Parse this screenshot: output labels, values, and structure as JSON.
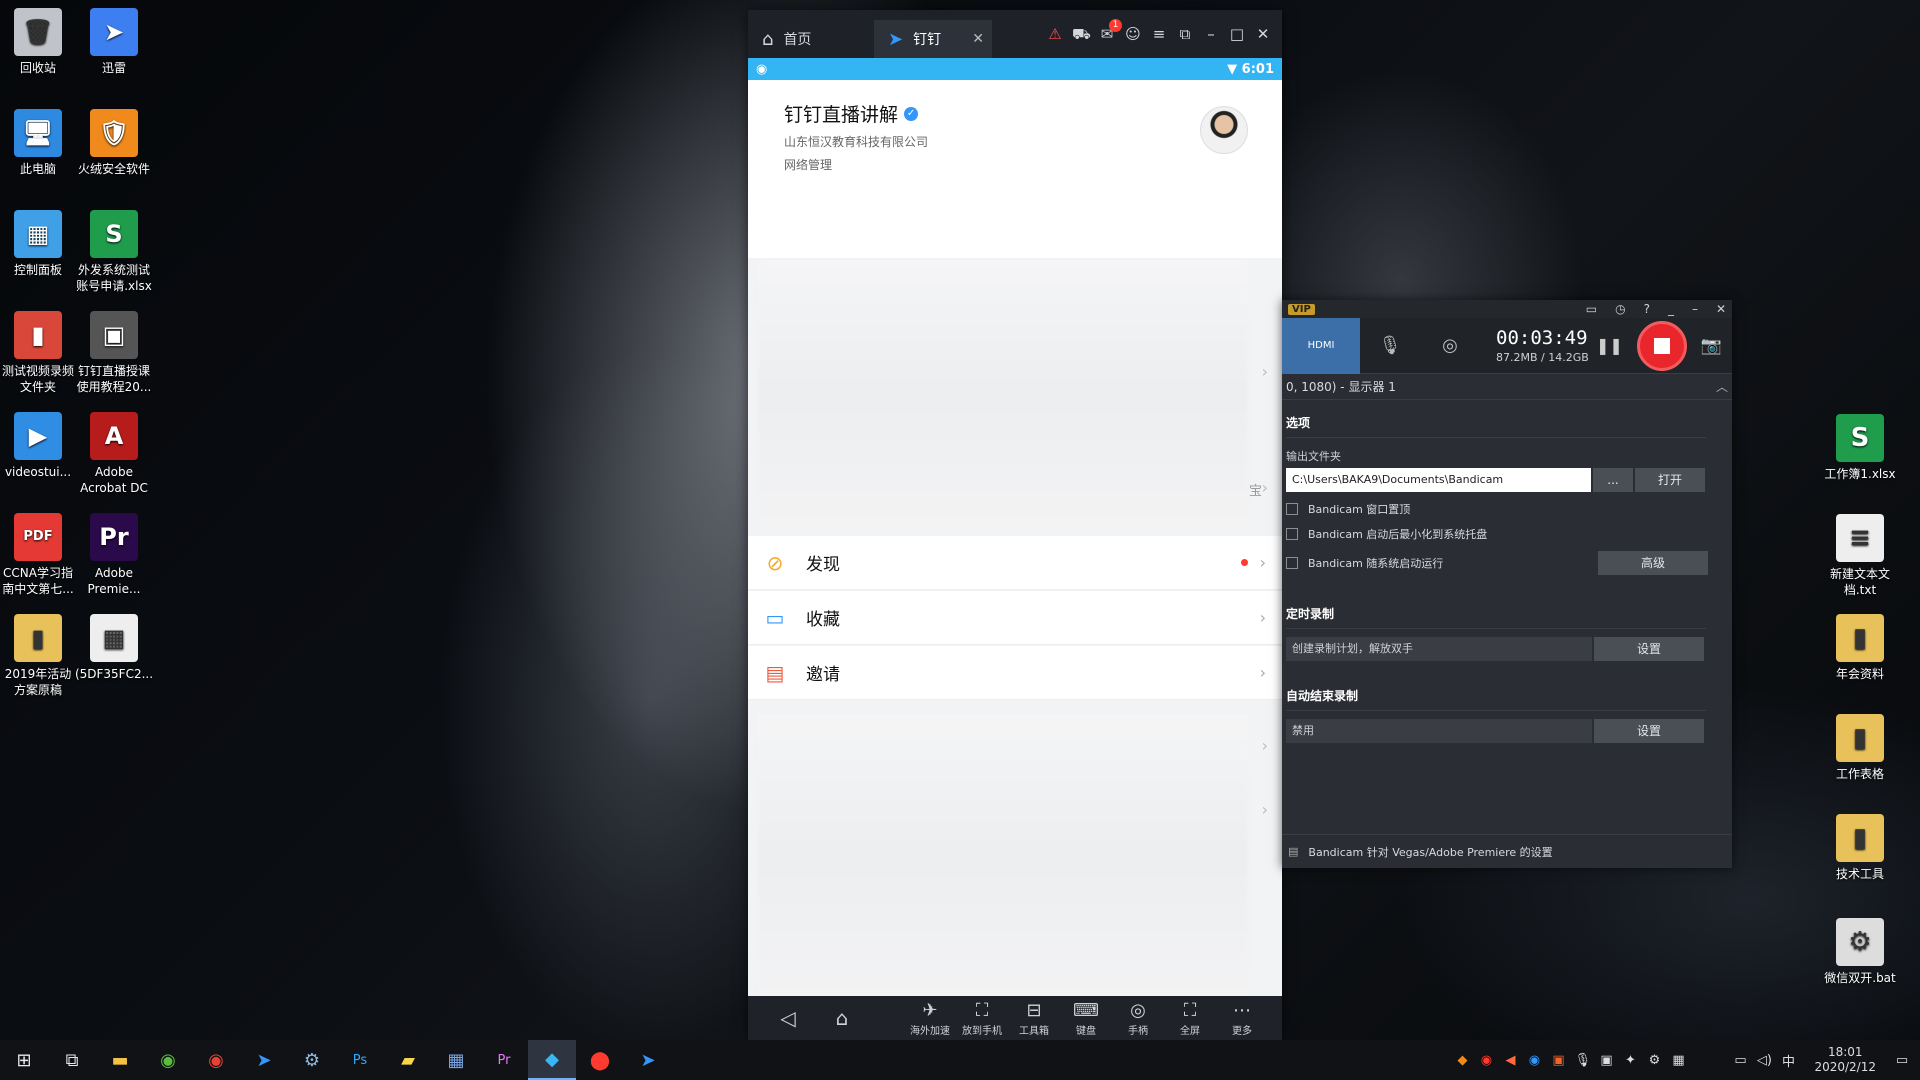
{
  "desktop_left": [
    {
      "label": "回收站",
      "icon": "🗑",
      "color": "#c0c4ca"
    },
    {
      "label": "迅雷",
      "icon": "➤",
      "color": "#3d7ff0"
    },
    {
      "label": "此电脑",
      "icon": "🖥",
      "color": "#2e89e0"
    },
    {
      "label": "火绒安全软件",
      "icon": "🛡",
      "color": "#f08a1c"
    },
    {
      "label": "控制面板",
      "icon": "▦",
      "color": "#3fa0e8"
    },
    {
      "label": "外发系统测试\n账号申请.xlsx",
      "icon": "S",
      "color": "#1f9d4d"
    },
    {
      "label": "测试视频录频\n文件夹",
      "icon": "▮",
      "color": "#d9463a"
    },
    {
      "label": "钉钉直播授课\n使用教程20...",
      "icon": "▣",
      "color": "#555"
    },
    {
      "label": "videostui...",
      "icon": "▶",
      "color": "#2f8de4"
    },
    {
      "label": "Adobe\nAcrobat DC",
      "icon": "A",
      "color": "#b71c1c"
    },
    {
      "label": "CCNA学习指\n南中文第七...",
      "icon": "PDF",
      "color": "#e53935"
    },
    {
      "label": "Adobe\nPremie...",
      "icon": "Pr",
      "color": "#2a0a4a"
    },
    {
      "label": "2019年活动\n方案原稿",
      "icon": "▮",
      "color": "#e8c15a"
    },
    {
      "label": "(5DF35FC2...",
      "icon": "▦",
      "color": "#eeeeee"
    }
  ],
  "desktop_right": [
    {
      "label": "工作簿1.xlsx",
      "icon": "S",
      "color": "#1f9d4d"
    },
    {
      "label": "新建文本文\n档.txt",
      "icon": "≡",
      "color": "#eeeeee"
    },
    {
      "label": "年会资料",
      "icon": "▮",
      "color": "#e8c15a"
    },
    {
      "label": "工作表格",
      "icon": "▮",
      "color": "#e8c15a"
    },
    {
      "label": "技术工具",
      "icon": "▮",
      "color": "#e8c15a"
    },
    {
      "label": "微信双开.bat",
      "icon": "⚙",
      "color": "#dddddd"
    }
  ],
  "emulator": {
    "home_tab": "首页",
    "app_tab": "钉钉",
    "status_time": "6:01",
    "profile": {
      "name": "钉钉直播讲解",
      "org": "山东恒汉教育科技有限公司",
      "dept": "网络管理"
    },
    "partial_label": "宝",
    "menu": [
      {
        "label": "发现",
        "icon": "⊘",
        "color": "#f5a623",
        "dot": true
      },
      {
        "label": "收藏",
        "icon": "▭",
        "color": "#3296fa",
        "dot": false
      },
      {
        "label": "邀请",
        "icon": "▤",
        "color": "#f05a3c",
        "dot": false
      }
    ],
    "nav_tools": [
      {
        "label": "海外加速",
        "icon": "✈"
      },
      {
        "label": "放到手机",
        "icon": "⛶"
      },
      {
        "label": "工具箱",
        "icon": "⊟"
      },
      {
        "label": "键盘",
        "icon": "⌨"
      },
      {
        "label": "手柄",
        "icon": "◎"
      },
      {
        "label": "全屏",
        "icon": "⛶"
      },
      {
        "label": "更多",
        "icon": "⋯"
      }
    ]
  },
  "bandicam": {
    "vip": "VIP",
    "mode": "HDMI",
    "time": "00:03:49",
    "size": "87.2MB / 14.2GB",
    "region": "0, 1080) - 显示器 1",
    "options_title": "选项",
    "output_label": "输出文件夹",
    "output_path": "C:\\Users\\BAKA9\\Documents\\Bandicam",
    "browse": "...",
    "open": "打开",
    "checks": [
      "Bandicam 窗口置顶",
      "Bandicam 启动后最小化到系统托盘",
      "Bandicam 随系统启动运行"
    ],
    "advanced": "高级",
    "timer_title": "定时录制",
    "timer_value": "创建录制计划，解放双手",
    "timer_btn": "设置",
    "autostop_title": "自动结束录制",
    "autostop_value": "禁用",
    "autostop_btn": "设置",
    "footer": "Bandicam 针对 Vegas/Adobe Premiere 的设置"
  },
  "taskbar": {
    "time": "18:01",
    "date": "2020/2/12",
    "ime": "中"
  }
}
